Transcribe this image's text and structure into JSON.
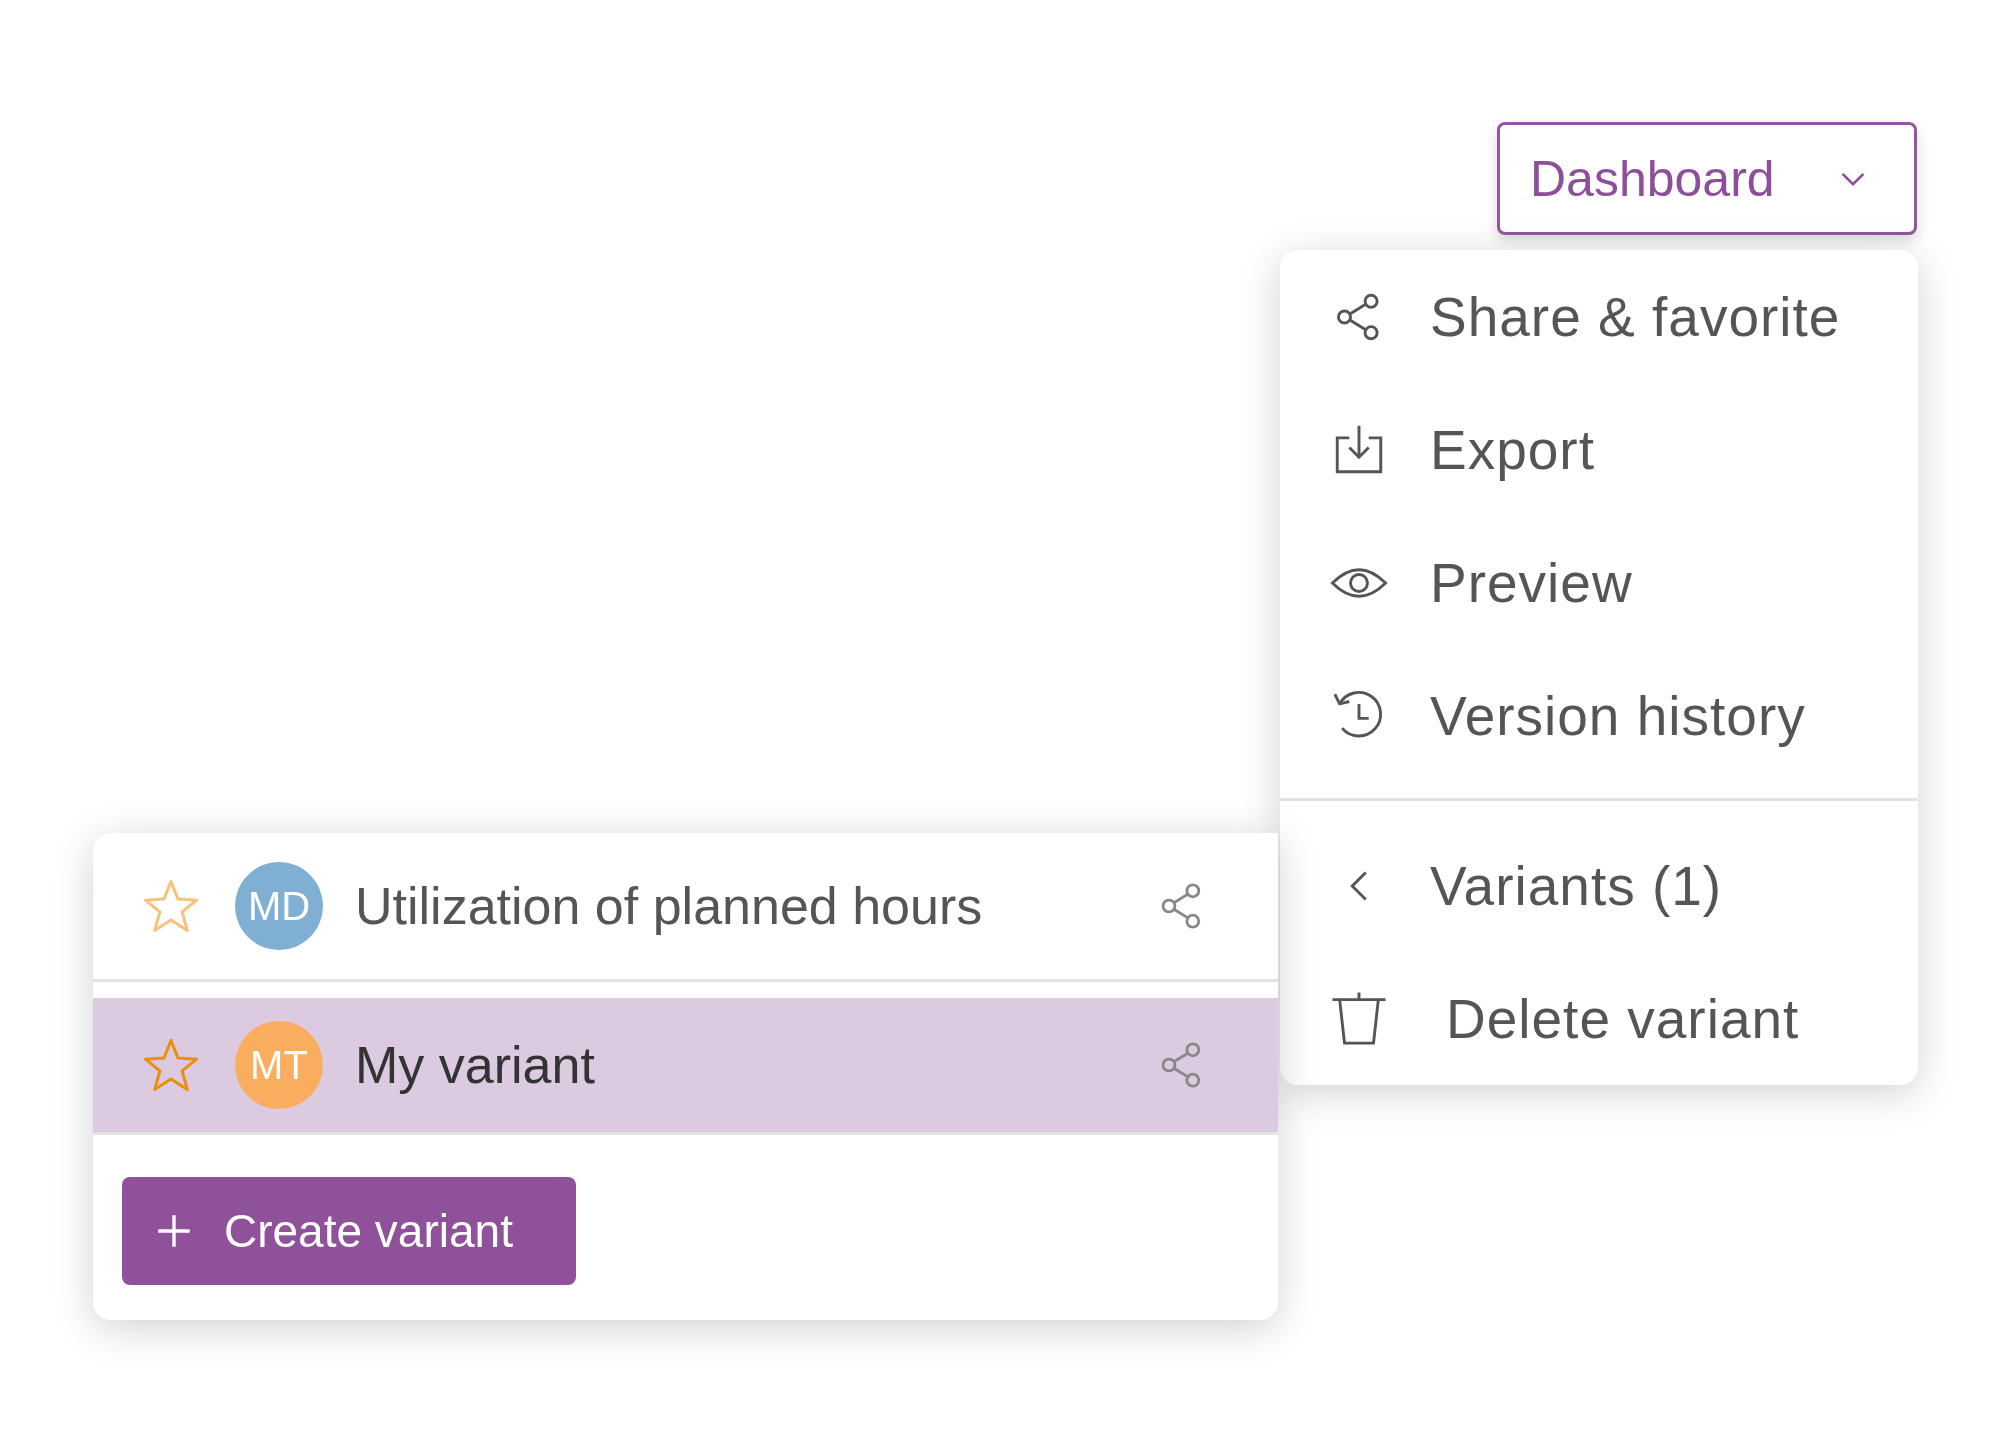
{
  "dashboard_button": {
    "label": "Dashboard"
  },
  "menu": {
    "items": [
      {
        "kind": "share",
        "label": "Share & favorite"
      },
      {
        "kind": "export",
        "label": "Export"
      },
      {
        "kind": "preview",
        "label": "Preview"
      },
      {
        "kind": "history",
        "label": "Version history"
      },
      {
        "kind": "submenu",
        "label": "Variants (1)"
      },
      {
        "kind": "delete",
        "label": "Delete variant"
      }
    ]
  },
  "variants": {
    "items": [
      {
        "name": "Utilization of planned hours",
        "initials": "MD",
        "color": "#7fb0d4",
        "favorite": false,
        "selected": false
      },
      {
        "name": "My variant",
        "initials": "MT",
        "color": "#f9ad5e",
        "favorite": true,
        "selected": true
      }
    ],
    "create_button": {
      "label": "Create variant"
    }
  }
}
